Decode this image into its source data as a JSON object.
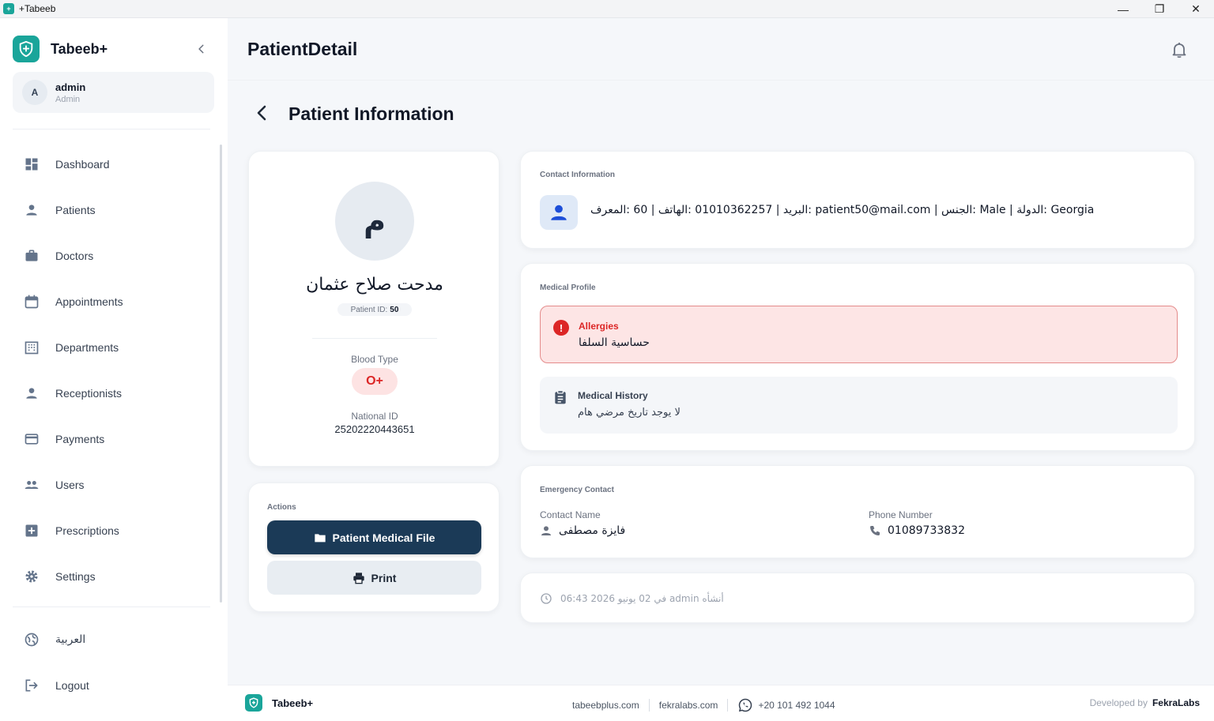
{
  "window": {
    "title": "+Tabeeb",
    "minimize": "—",
    "restore": "❐",
    "close": "✕"
  },
  "sidebar": {
    "brand": "Tabeeb+",
    "user": {
      "initial": "A",
      "name": "admin",
      "role": "Admin"
    },
    "items": [
      {
        "label": "Dashboard",
        "icon": "dashboard-icon"
      },
      {
        "label": "Patients",
        "icon": "person-icon"
      },
      {
        "label": "Doctors",
        "icon": "briefcase-icon"
      },
      {
        "label": "Appointments",
        "icon": "calendar-icon"
      },
      {
        "label": "Departments",
        "icon": "building-icon"
      },
      {
        "label": "Receptionists",
        "icon": "person-icon"
      },
      {
        "label": "Payments",
        "icon": "credit-card-icon"
      },
      {
        "label": "Users",
        "icon": "users-icon"
      },
      {
        "label": "Prescriptions",
        "icon": "plus-box-icon"
      },
      {
        "label": "Settings",
        "icon": "gear-icon"
      }
    ],
    "bottom": [
      {
        "label": "العربية",
        "icon": "globe-icon"
      },
      {
        "label": "Logout",
        "icon": "logout-icon"
      }
    ]
  },
  "header": {
    "title": "PatientDetail"
  },
  "section": {
    "title": "Patient Information"
  },
  "profile": {
    "avatar_initial": "م",
    "name": "مدحت صلاح عثمان",
    "patient_id_label": "Patient ID:",
    "patient_id": "50",
    "blood_type_label": "Blood Type",
    "blood_type": "O+",
    "national_id_label": "National ID",
    "national_id": "25202220443651"
  },
  "actions": {
    "label": "Actions",
    "medical_file": "Patient Medical File",
    "print": "Print"
  },
  "contact": {
    "label": "Contact Information",
    "text": "البريد | 01010362257 :الهاتف | 60 :المعرف: patient50@mail.com | الجنس: Male | الدولة: Georgia"
  },
  "medical": {
    "label": "Medical Profile",
    "allergies_title": "Allergies",
    "allergies_value": "حساسية السلفا",
    "history_title": "Medical History",
    "history_value": "لا يوجد تاريخ مرضي هام"
  },
  "emergency": {
    "label": "Emergency Contact",
    "name_label": "Contact Name",
    "name_value": "فايزة مصطفى",
    "phone_label": "Phone Number",
    "phone_value": "01089733832"
  },
  "created": {
    "text": "في 02 يونيو 2026 06:43 admin أنشأه"
  },
  "footer": {
    "brand": "Tabeeb+",
    "site1": "tabeebplus.com",
    "site2": "fekralabs.com",
    "phone": "+20 101 492 1044",
    "dev_label": "Developed by",
    "dev_name": "FekraLabs"
  },
  "colors": {
    "accent": "#1aa59a",
    "primary_button": "#1b3a57",
    "danger": "#dc2626"
  }
}
